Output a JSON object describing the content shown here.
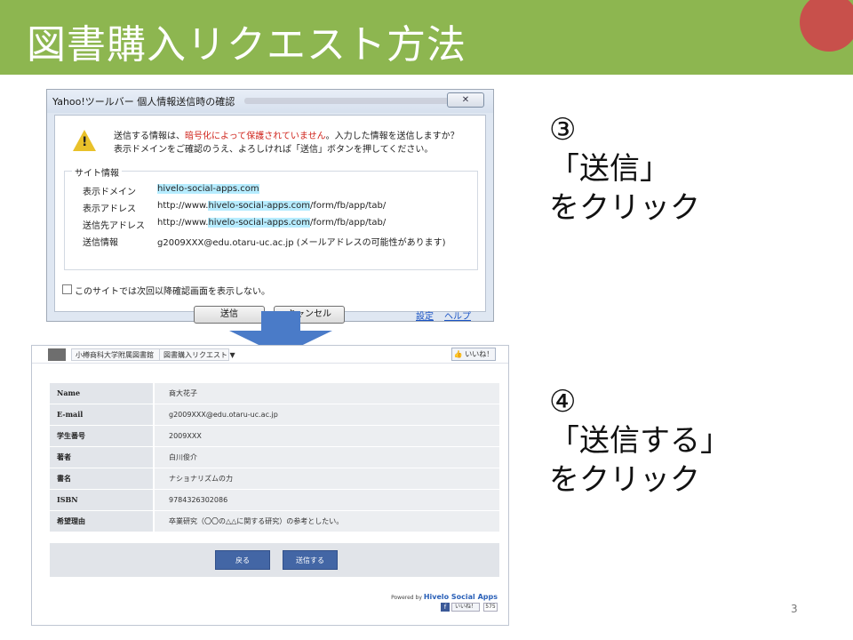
{
  "slide": {
    "title": "図書購入リクエスト方法",
    "page_number": "3",
    "colors": {
      "header": "#8db650",
      "accent": "#c8504b",
      "arrow": "#4a7bc8"
    }
  },
  "dialog": {
    "title": "Yahoo!ツールバー 個人情報送信時の確認",
    "close_icon": "close-icon",
    "message_line1_prefix": "送信する情報は、",
    "message_line1_warning": "暗号化によって保護されていません",
    "message_line1_suffix": "。入力した情報を送信しますか？",
    "message_line2": "表示ドメインをご確認のうえ、よろしければ「送信」ボタンを押してください。",
    "group_label": "サイト情報",
    "rows": [
      {
        "label": "表示ドメイン",
        "prefix": "",
        "highlight": "hivelo-social-apps.com",
        "suffix": ""
      },
      {
        "label": "表示アドレス",
        "prefix": "http://www.",
        "highlight": "hivelo-social-apps.com",
        "suffix": "/form/fb/app/tab/"
      },
      {
        "label": "送信先アドレス",
        "prefix": "http://www.",
        "highlight": "hivelo-social-apps.com",
        "suffix": "/form/fb/app/tab/"
      },
      {
        "label": "送信情報",
        "prefix": "g2009XXX@edu.otaru-uc.ac.jp (メールアドレスの可能性があります)",
        "highlight": "",
        "suffix": ""
      }
    ],
    "checkbox_label": "このサイトでは次回以降確認画面を表示しない。",
    "send_button": "送信",
    "cancel_button": "キャンセル",
    "settings_link": "設定",
    "help_link": "ヘルプ"
  },
  "form": {
    "page_name": "小樽商科大学附属図書館",
    "tab_name": "図書購入リクエスト ▼",
    "like_button": "👍 いいね！",
    "rows": [
      {
        "label": "Name",
        "value": "商大花子"
      },
      {
        "label": "E-mail",
        "value": "g2009XXX@edu.otaru-uc.ac.jp"
      },
      {
        "label": "学生番号",
        "value": "2009XXX"
      },
      {
        "label": "著者",
        "value": "白川俊介"
      },
      {
        "label": "書名",
        "value": "ナショナリズムの力"
      },
      {
        "label": "ISBN",
        "value": "9784326302086"
      },
      {
        "label": "希望理由",
        "value": "卒業研究（〇〇の△△に関する研究）の参考としたい。"
      }
    ],
    "back_button": "戻る",
    "submit_button": "送信する",
    "powered_by": "Powered by",
    "brand": "Hivelo Social Apps",
    "fb_like_label": "いいね！",
    "fb_like_count": "575"
  },
  "steps": {
    "step3": {
      "number": "③",
      "line1": "「送信」",
      "line2": "をクリック"
    },
    "step4": {
      "number": "④",
      "line1": "「送信する」",
      "line2": "をクリック"
    }
  }
}
